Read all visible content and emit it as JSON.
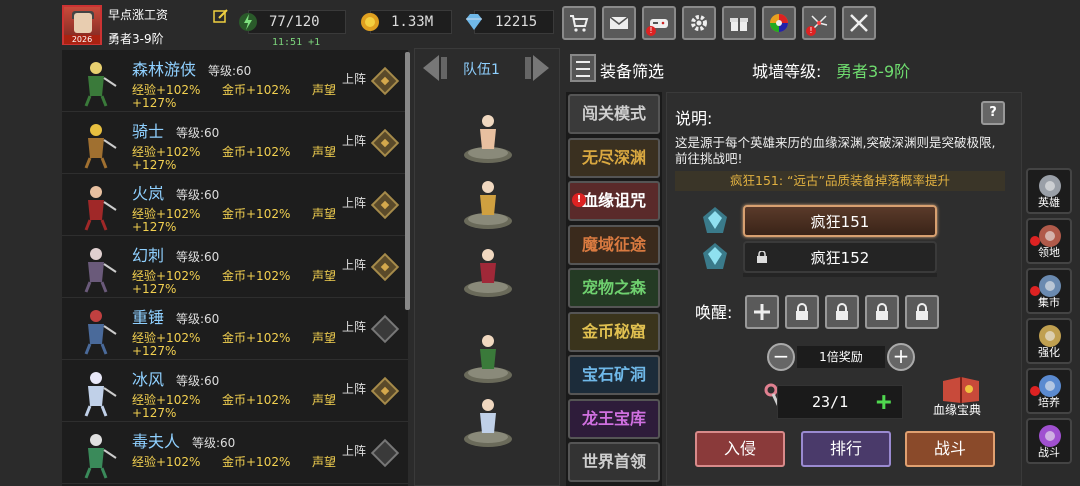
{
  "player": {
    "name": "早点涨工资",
    "rank": "勇者3-9阶",
    "avatar_level": "2026"
  },
  "resources": {
    "stamina": "77/120",
    "stamina_regen": "11:51 +1",
    "gold": "1.33M",
    "diamonds": "12215"
  },
  "top_buttons": [
    "shop-cart-icon",
    "mail-icon",
    "gamepad-icon",
    "settings-gear-icon",
    "gift-icon",
    "color-wheel-icon",
    "fireworks-icon",
    "battle-swords-icon"
  ],
  "heroes": [
    {
      "name": "森林游侠",
      "level": "等级:60",
      "exp": "经验+102%",
      "gold": "金币+102%",
      "fame": "声望",
      "pct": "+127%",
      "deploy": "上阵",
      "active": true
    },
    {
      "name": "骑士",
      "level": "等级:60",
      "exp": "经验+102%",
      "gold": "金币+102%",
      "fame": "声望",
      "pct": "+127%",
      "deploy": "上阵",
      "active": true
    },
    {
      "name": "火岚",
      "level": "等级:60",
      "exp": "经验+102%",
      "gold": "金币+102%",
      "fame": "声望",
      "pct": "+127%",
      "deploy": "上阵",
      "active": true
    },
    {
      "name": "幻刺",
      "level": "等级:60",
      "exp": "经验+102%",
      "gold": "金币+102%",
      "fame": "声望",
      "pct": "+127%",
      "deploy": "上阵",
      "active": true
    },
    {
      "name": "重锤",
      "level": "等级:60",
      "exp": "经验+102%",
      "gold": "金币+102%",
      "fame": "声望",
      "pct": "+127%",
      "deploy": "上阵",
      "active": false
    },
    {
      "name": "冰风",
      "level": "等级:60",
      "exp": "经验+102%",
      "gold": "金币+102%",
      "fame": "声望",
      "pct": "+127%",
      "deploy": "上阵",
      "active": true
    },
    {
      "name": "毒夫人",
      "level": "等级:60",
      "exp": "经验+102%",
      "gold": "金币+102%",
      "fame": "声望",
      "pct": "",
      "deploy": "上阵",
      "active": false
    }
  ],
  "team": {
    "label": "队伍1"
  },
  "filter": {
    "label": "装备筛选",
    "wall_label": "城墙等级:",
    "wall_value": "勇者3-9阶"
  },
  "modes": [
    {
      "label": "闯关模式",
      "color": "#cfcfcf",
      "bg": "#3a3a3a",
      "alert": false
    },
    {
      "label": "无尽深渊",
      "color": "#d9a840",
      "bg": "#3a3020",
      "alert": false
    },
    {
      "label": "血缘诅咒",
      "color": "#ffffff",
      "bg": "#5a2a2a",
      "alert": true
    },
    {
      "label": "魔域征途",
      "color": "#d97a40",
      "bg": "#3a2a1c",
      "alert": false
    },
    {
      "label": "宠物之森",
      "color": "#6fd06f",
      "bg": "#243a24",
      "alert": false
    },
    {
      "label": "金币秘窟",
      "color": "#e0c050",
      "bg": "#3a341c",
      "alert": false
    },
    {
      "label": "宝石矿洞",
      "color": "#6fb8e8",
      "bg": "#1c2c3a",
      "alert": false
    },
    {
      "label": "龙王宝库",
      "color": "#d070e0",
      "bg": "#2e1c3a",
      "alert": false
    },
    {
      "label": "世界首领",
      "color": "#cfcfcf",
      "bg": "#333333",
      "alert": false
    }
  ],
  "detail": {
    "title": "说明:",
    "help": "?",
    "description": "这是源于每个英雄来历的血缘深渊,突破深渊则是突破极限,前往挑战吧!",
    "banner": "疯狂151: “远古”品质装备掉落概率提升",
    "floors": [
      "疯狂151",
      "疯狂152"
    ],
    "awaken_label": "唤醒:",
    "multiplier": "1倍奖励",
    "count": "23/1",
    "book_label": "血缘宝典",
    "actions": [
      "入侵",
      "排行",
      "战斗"
    ]
  },
  "sidebar": [
    "英雄",
    "领地",
    "集市",
    "强化",
    "培养",
    "战斗"
  ]
}
